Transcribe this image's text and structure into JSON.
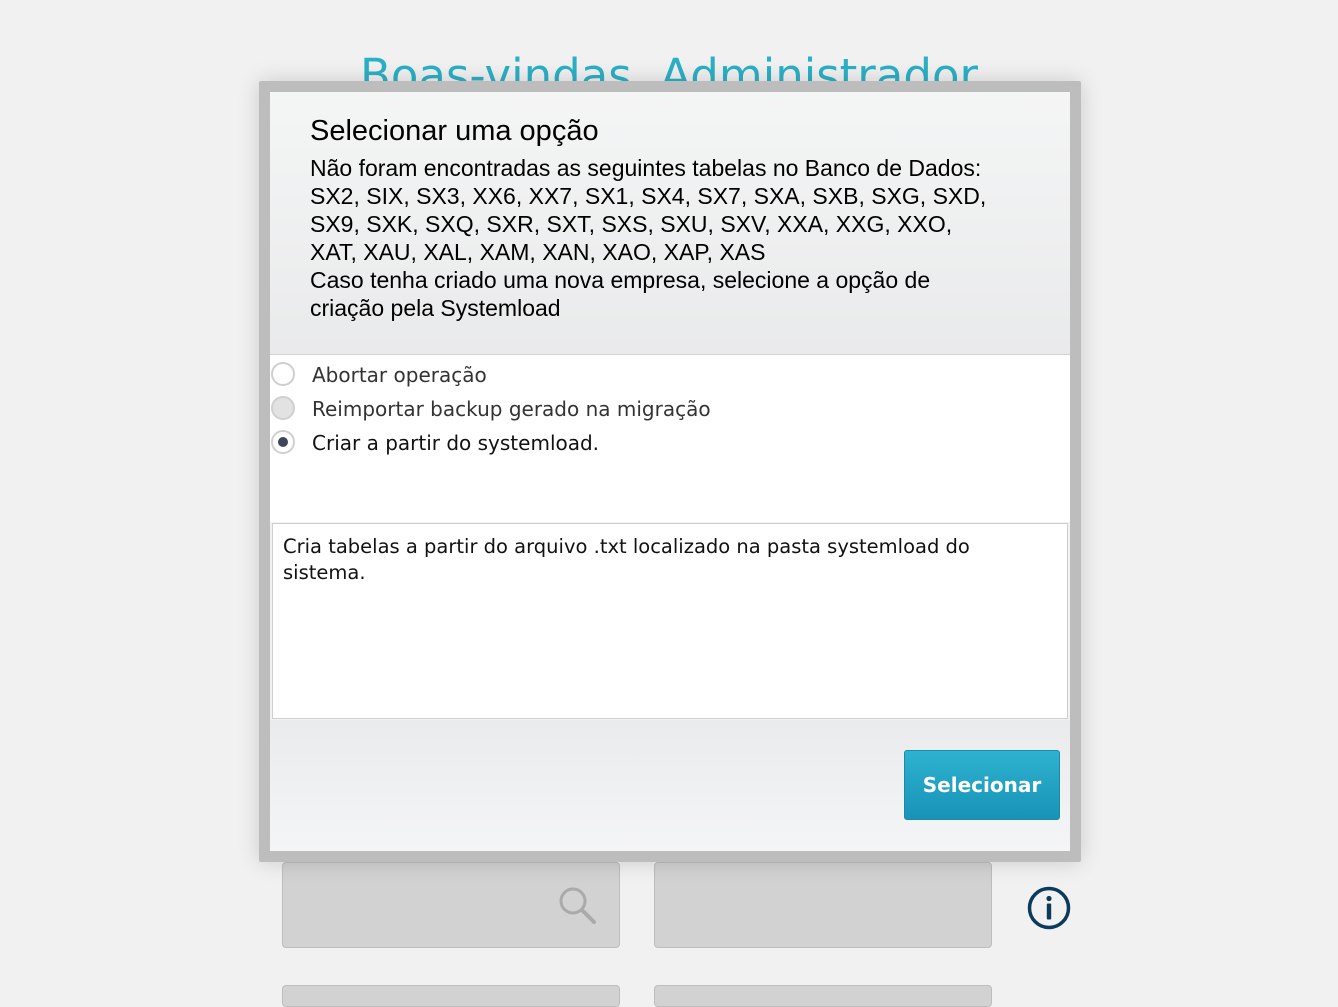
{
  "background": {
    "welcome_title": "Boas-vindas, Administrador",
    "icons": {
      "search": "search-icon",
      "info": "info-icon"
    }
  },
  "dialog": {
    "title": "Selecionar uma opção",
    "message": "Não foram encontradas as seguintes tabelas no Banco de Dados:\nSX2, SIX, SX3, XX6, XX7, SX1, SX4, SX7, SXA, SXB, SXG, SXD,\nSX9, SXK, SXQ, SXR, SXT, SXS, SXU, SXV, XXA, XXG, XXO,\nXAT, XAU, XAL, XAM, XAN, XAO, XAP, XAS\nCaso tenha criado uma nova empresa, selecione a opção de\ncriação pela Systemload",
    "options": [
      {
        "label": "Abortar operação",
        "state": "unchecked"
      },
      {
        "label": "Reimportar backup gerado na migração",
        "state": "disabled"
      },
      {
        "label": "Criar a partir do systemload.",
        "state": "checked"
      }
    ],
    "description": "Cria tabelas a partir do arquivo .txt localizado na pasta systemload do sistema.",
    "select_button": "Selecionar"
  },
  "colors": {
    "accent": "#2bb0c6",
    "button": "#1f9fc3",
    "radio_checked": "#3d4659",
    "info_icon": "#0b3a5c"
  }
}
